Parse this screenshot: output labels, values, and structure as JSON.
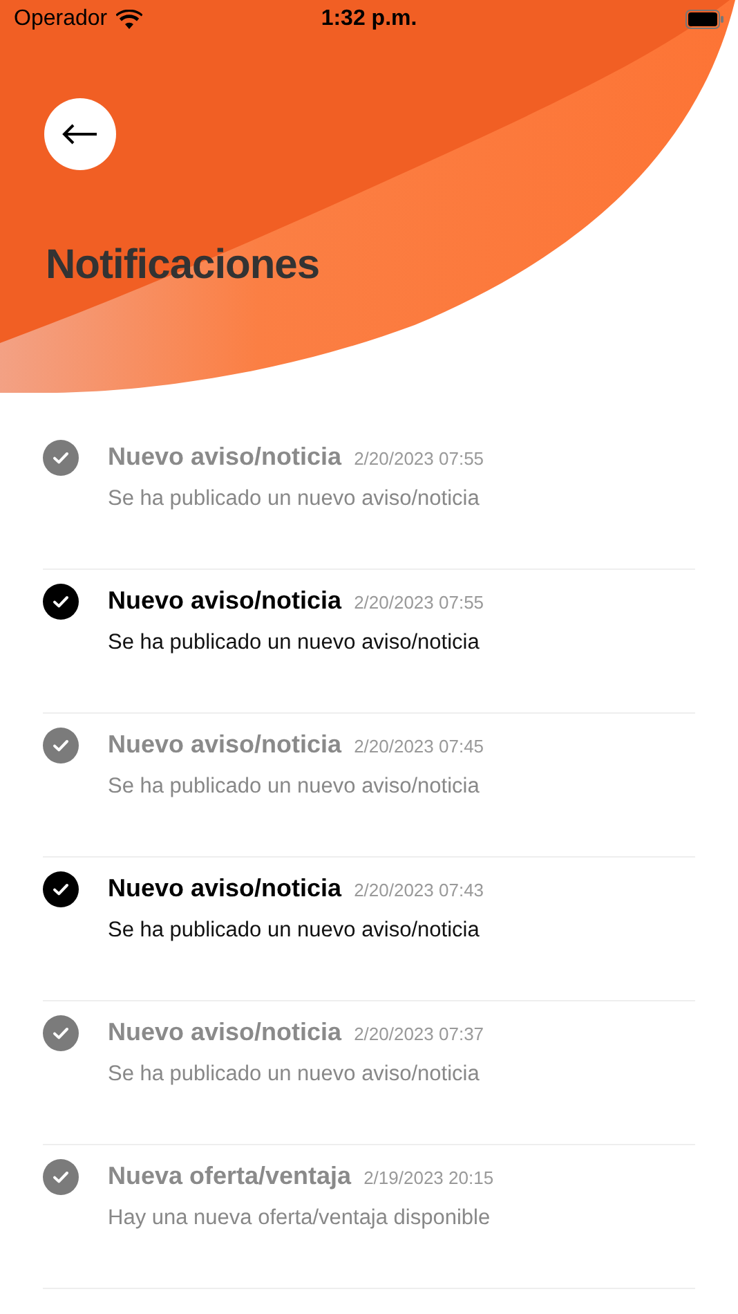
{
  "status_bar": {
    "carrier": "Operador",
    "time": "1:32 p.m."
  },
  "header": {
    "title": "Notificaciones"
  },
  "notifications": [
    {
      "title": "Nuevo aviso/noticia",
      "date": "2/20/2023 07:55",
      "body": "Se ha publicado un nuevo aviso/noticia",
      "read": true
    },
    {
      "title": "Nuevo aviso/noticia",
      "date": "2/20/2023 07:55",
      "body": "Se ha publicado un nuevo aviso/noticia",
      "read": false
    },
    {
      "title": "Nuevo aviso/noticia",
      "date": "2/20/2023 07:45",
      "body": "Se ha publicado un nuevo aviso/noticia",
      "read": true
    },
    {
      "title": "Nuevo aviso/noticia",
      "date": "2/20/2023 07:43",
      "body": "Se ha publicado un nuevo aviso/noticia",
      "read": false
    },
    {
      "title": "Nuevo aviso/noticia",
      "date": "2/20/2023 07:37",
      "body": "Se ha publicado un nuevo aviso/noticia",
      "read": true
    },
    {
      "title": "Nueva oferta/ventaja",
      "date": "2/19/2023 20:15",
      "body": "Hay una nueva oferta/ventaja disponible",
      "read": true
    }
  ]
}
